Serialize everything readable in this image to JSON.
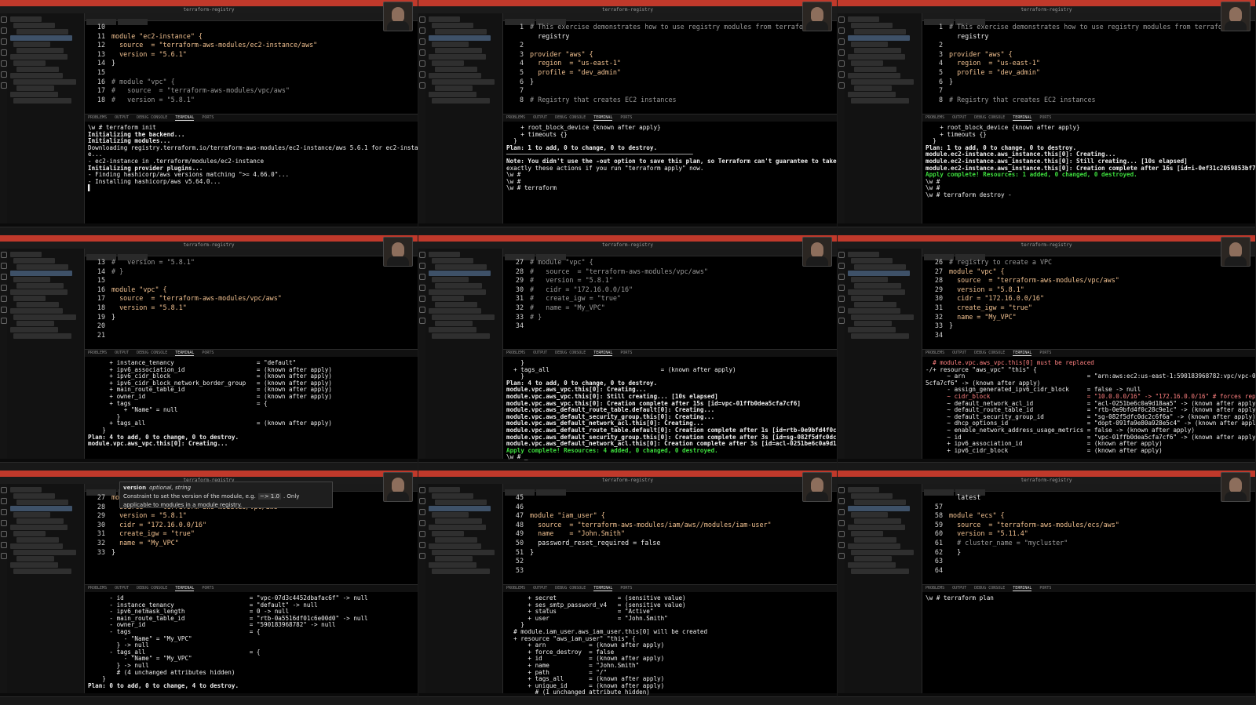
{
  "window_title": "terraform-registry",
  "panel_tabs": [
    "PROBLEMS",
    "OUTPUT",
    "DEBUG CONSOLE",
    "TERMINAL",
    "PORTS"
  ],
  "tiles": [
    {
      "code": [
        {
          "n": "10",
          "t": ""
        },
        {
          "n": "11",
          "t": "module \"ec2-instance\" {"
        },
        {
          "n": "12",
          "t": "  source  = \"terraform-aws-modules/ec2-instance/aws\""
        },
        {
          "n": "13",
          "t": "  version = \"5.6.1\""
        },
        {
          "n": "14",
          "t": "}"
        },
        {
          "n": "15",
          "t": ""
        },
        {
          "n": "16",
          "t": "# module \"vpc\" {"
        },
        {
          "n": "17",
          "t": "#   source  = \"terraform-aws-modules/vpc/aws\""
        },
        {
          "n": "18",
          "t": "#   version = \"5.8.1\""
        }
      ],
      "term": [
        "\\w # terraform init",
        "Initializing the backend...",
        "Initializing modules...",
        "Downloading registry.terraform.io/terraform-aws-modules/ec2-instance/aws 5.6.1 for ec2-instanc",
        "e...",
        "- ec2-instance in .terraform/modules/ec2-instance",
        "Initializing provider plugins...",
        "- Finding hashicorp/aws versions matching \">= 4.66.0\"...",
        "- Installing hashicorp/aws v5.64.0...",
        "▌"
      ]
    },
    {
      "code": [
        {
          "n": "1",
          "t": "# This exercise demonstrates how to use registry modules from terraform"
        },
        {
          "n": "",
          "t": "  registry"
        },
        {
          "n": "2",
          "t": ""
        },
        {
          "n": "3",
          "t": "provider \"aws\" {"
        },
        {
          "n": "4",
          "t": "  region  = \"us-east-1\""
        },
        {
          "n": "5",
          "t": "  profile = \"dev_admin\""
        },
        {
          "n": "6",
          "t": "}"
        },
        {
          "n": "7",
          "t": ""
        },
        {
          "n": "8",
          "t": "# Registry that creates EC2 instances"
        }
      ],
      "term": [
        "",
        "    + root_block_device {known after apply}",
        "",
        "    + timeouts {}",
        "  }",
        "",
        "Plan: 1 to add, 0 to change, 0 to destroy.",
        "",
        "────────────────────────────────────────────────────",
        "",
        "Note: You didn't use the -out option to save this plan, so Terraform can't guarantee to take",
        "exactly these actions if you run \"terraform apply\" now.",
        "\\w #",
        "\\w #",
        "\\w # terraform"
      ]
    },
    {
      "code": [
        {
          "n": "1",
          "t": "# This exercise demonstrates how to use registry modules from terraform"
        },
        {
          "n": "",
          "t": "  registry"
        },
        {
          "n": "2",
          "t": ""
        },
        {
          "n": "3",
          "t": "provider \"aws\" {"
        },
        {
          "n": "4",
          "t": "  region  = \"us-east-1\""
        },
        {
          "n": "5",
          "t": "  profile = \"dev_admin\""
        },
        {
          "n": "6",
          "t": "}"
        },
        {
          "n": "7",
          "t": ""
        },
        {
          "n": "8",
          "t": "# Registry that creates EC2 instances"
        }
      ],
      "term": [
        "",
        "    + root_block_device {known after apply}",
        "",
        "    + timeouts {}",
        "  }",
        "",
        "Plan: 1 to add, 0 to change, 0 to destroy.",
        "module.ec2-instance.aws_instance.this[0]: Creating...",
        "module.ec2-instance.aws_instance.this[0]: Still creating... [10s elapsed]",
        "module.ec2-instance.aws_instance.this[0]: Creation complete after 16s [id=i-0ef31c2059853bf7b]",
        "",
        "Apply complete! Resources: 1 added, 0 changed, 0 destroyed.",
        "\\w #",
        "\\w #",
        "\\w # terraform destroy -"
      ]
    },
    {
      "code": [
        {
          "n": "13",
          "t": "#   version = \"5.8.1\""
        },
        {
          "n": "14",
          "t": "# }"
        },
        {
          "n": "15",
          "t": ""
        },
        {
          "n": "16",
          "t": "module \"vpc\" {"
        },
        {
          "n": "17",
          "t": "  source  = \"terraform-aws-modules/vpc/aws\""
        },
        {
          "n": "18",
          "t": "  version = \"5.8.1\""
        },
        {
          "n": "19",
          "t": "}"
        },
        {
          "n": "20",
          "t": ""
        },
        {
          "n": "21",
          "t": ""
        }
      ],
      "term": [
        "",
        "      + instance_tenancy                       = \"default\"",
        "      + ipv6_association_id                    = (known after apply)",
        "      + ipv6_cidr_block                        = (known after apply)",
        "      + ipv6_cidr_block_network_border_group   = (known after apply)",
        "      + main_route_table_id                    = (known after apply)",
        "      + owner_id                               = (known after apply)",
        "      + tags                                   = {",
        "          + \"Name\" = null",
        "        }",
        "      + tags_all                               = (known after apply)",
        "    }",
        "",
        "Plan: 4 to add, 0 to change, 0 to destroy.",
        "module.vpc.aws_vpc.this[0]: Creating..."
      ]
    },
    {
      "code": [
        {
          "n": "27",
          "t": "# module \"vpc\" {"
        },
        {
          "n": "28",
          "t": "#   source  = \"terraform-aws-modules/vpc/aws\""
        },
        {
          "n": "29",
          "t": "#   version = \"5.8.1\""
        },
        {
          "n": "30",
          "t": "#   cidr = \"172.16.0.0/16\""
        },
        {
          "n": "31",
          "t": "#   create_igw = \"true\""
        },
        {
          "n": "32",
          "t": "#   name = \"My_VPC\""
        },
        {
          "n": "33",
          "t": "# }"
        },
        {
          "n": "34",
          "t": ""
        }
      ],
      "term": [
        "    }",
        "  + tags_all                               = (known after apply)",
        "    }",
        "",
        "Plan: 4 to add, 0 to change, 0 to destroy.",
        "module.vpc.aws_vpc.this[0]: Creating...",
        "module.vpc.aws_vpc.this[0]: Still creating... [10s elapsed]",
        "module.vpc.aws_vpc.this[0]: Creation complete after 15s [id=vpc-01ffb0dea5cfa7cf6]",
        "module.vpc.aws_default_route_table.default[0]: Creating...",
        "module.vpc.aws_default_security_group.this[0]: Creating...",
        "module.vpc.aws_default_network_acl.this[0]: Creating...",
        "module.vpc.aws_default_route_table.default[0]: Creation complete after 1s [id=rtb-0e9bfd4f0c28c9e1c]",
        "module.vpc.aws_default_security_group.this[0]: Creation complete after 3s [id=sg-082f5dfc0dc2c6f6a]",
        "module.vpc.aws_default_network_acl.this[0]: Creation complete after 3s [id=acl-0251be6c0a9d18aa5]",
        "",
        "Apply complete! Resources: 4 added, 0 changed, 0 destroyed.",
        "\\w # _"
      ]
    },
    {
      "code": [
        {
          "n": "26",
          "t": "# registry to create a VPC"
        },
        {
          "n": "27",
          "t": "module \"vpc\" {"
        },
        {
          "n": "28",
          "t": "  source  = \"terraform-aws-modules/vpc/aws\""
        },
        {
          "n": "29",
          "t": "  version = \"5.8.1\""
        },
        {
          "n": "30",
          "t": "  cidr = \"172.16.0.0/16\""
        },
        {
          "n": "31",
          "t": "  create_igw = \"true\""
        },
        {
          "n": "32",
          "t": "  name = \"My_VPC\""
        },
        {
          "n": "33",
          "t": "}"
        },
        {
          "n": "34",
          "t": ""
        }
      ],
      "term": [
        "",
        "  # module.vpc.aws_vpc.this[0] must be replaced",
        "-/+ resource \"aws_vpc\" \"this\" {",
        "      ~ arn                                  = \"arn:aws:ec2:us-east-1:590183968782:vpc/vpc-01ffb0dea",
        "5cfa7cf6\" -> (known after apply)",
        "      - assign_generated_ipv6_cidr_block     = false -> null",
        "      ~ cidr_block                           = \"10.0.0.0/16\" -> \"172.16.0.0/16\" # forces replacement",
        "      ~ default_network_acl_id               = \"acl-0251be6c0a9d18aa5\" -> (known after apply)",
        "      ~ default_route_table_id               = \"rtb-0e9bfd4f0c28c9e1c\" -> (known after apply)",
        "      ~ default_security_group_id            = \"sg-082f5dfc0dc2c6f6a\" -> (known after apply)",
        "      ~ dhcp_options_id                      = \"dopt-091fa9e80a928e5c4\" -> (known after apply)",
        "      ~ enable_network_address_usage_metrics = false -> (known after apply)",
        "      ~ id                                   = \"vpc-01ffb0dea5cfa7cf6\" -> (known after apply)",
        "      + ipv6_association_id                  = (known after apply)",
        "      + ipv6_cidr_block                      = (known after apply)"
      ]
    },
    {
      "code": [
        {
          "n": "27",
          "t": "module \"vpc\" {"
        },
        {
          "n": "28",
          "t": "  source  = \"terraform-aws-modules/vpc/aws\""
        },
        {
          "n": "29",
          "t": "  version = \"5.8.1\""
        },
        {
          "n": "30",
          "t": "  cidr = \"172.16.0.0/16\""
        },
        {
          "n": "31",
          "t": "  create_igw = \"true\""
        },
        {
          "n": "32",
          "t": "  name = \"My_VPC\""
        },
        {
          "n": "33",
          "t": "}"
        }
      ],
      "tooltip": {
        "title": "version",
        "meta": "optional, string",
        "desc": "Constraint to set the version of the module, e.g.",
        "example": "~> 1.0",
        "desc2": ". Only applicable to modules in a module registry."
      },
      "term": [
        "      - id                                   = \"vpc-07d3c4452dbafac6f\" -> null",
        "      - instance_tenancy                     = \"default\" -> null",
        "      - ipv6_netmask_length                  = 0 -> null",
        "      - main_route_table_id                  = \"rtb-0a5516df01c6e00d0\" -> null",
        "      - owner_id                             = \"590183968782\" -> null",
        "      - tags                                 = {",
        "          - \"Name\" = \"My_VPC\"",
        "        } -> null",
        "      - tags_all                             = {",
        "          - \"Name\" = \"My_VPC\"",
        "        } -> null",
        "        # (4 unchanged attributes hidden)",
        "    }",
        "",
        "Plan: 0 to add, 0 to change, 4 to destroy."
      ]
    },
    {
      "code": [
        {
          "n": "45",
          "t": ""
        },
        {
          "n": "46",
          "t": ""
        },
        {
          "n": "47",
          "t": "module \"iam_user\" {"
        },
        {
          "n": "48",
          "t": "  source  = \"terraform-aws-modules/iam/aws//modules/iam-user\""
        },
        {
          "n": "49",
          "t": "  name    = \"John.Smith\""
        },
        {
          "n": "50",
          "t": "  password_reset_required = false"
        },
        {
          "n": "51",
          "t": "}"
        },
        {
          "n": "52",
          "t": ""
        },
        {
          "n": "53",
          "t": ""
        }
      ],
      "term": [
        "      + secret                 = (sensitive value)",
        "      + ses_smtp_password_v4   = (sensitive value)",
        "      + status                 = \"Active\"",
        "      + user                   = \"John.Smith\"",
        "    }",
        "",
        "  # module.iam_user.aws_iam_user.this[0] will be created",
        "  + resource \"aws_iam_user\" \"this\" {",
        "      + arn            = (known after apply)",
        "      + force_destroy  = false",
        "      + id             = (known after apply)",
        "      + name           = \"John.Smith\"",
        "      + path           = \"/\"",
        "      + tags_all       = (known after apply)",
        "      + unique_id      = (known after apply)",
        "        # (1 unchanged attribute hidden)"
      ]
    },
    {
      "code": [
        {
          "n": "",
          "t": "  latest"
        },
        {
          "n": "57",
          "t": ""
        },
        {
          "n": "58",
          "t": "module \"ecs\" {"
        },
        {
          "n": "59",
          "t": "  source  = \"terraform-aws-modules/ecs/aws\""
        },
        {
          "n": "60",
          "t": "  version = \"5.11.4\""
        },
        {
          "n": "61",
          "t": "  # cluster_name = \"mycluster\""
        },
        {
          "n": "62",
          "t": "  }"
        },
        {
          "n": "63",
          "t": ""
        },
        {
          "n": "64",
          "t": ""
        }
      ],
      "term": [
        "\\w # terraform plan"
      ]
    }
  ]
}
